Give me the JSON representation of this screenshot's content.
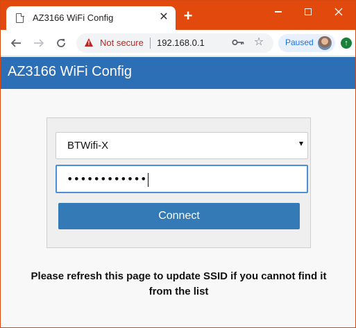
{
  "browser": {
    "tab_title": "AZ3166 WiFi Config",
    "close_glyph": "✕",
    "new_tab_glyph": "+",
    "security_label": "Not secure",
    "url": "192.168.0.1",
    "profile_status": "Paused",
    "icons": {
      "back": "arrow-left",
      "forward": "arrow-right",
      "reload": "reload",
      "warning": "warning-triangle",
      "key": "key",
      "star": "star",
      "extension": "extension-update"
    },
    "colors": {
      "titlebar": "#e14a0c",
      "warning": "#c5221f",
      "paused_bg": "#e8f0fe",
      "paused_text": "#1a73e8"
    }
  },
  "page": {
    "title": "AZ3166 WiFi Config",
    "header_color": "#2d6fb7",
    "form": {
      "ssid_selected": "BTWifi-X",
      "password_masked": "••••••••••••",
      "connect_label": "Connect",
      "button_color": "#337ab7"
    },
    "note": "Please refresh this page to update SSID if you cannot find it from the list"
  }
}
